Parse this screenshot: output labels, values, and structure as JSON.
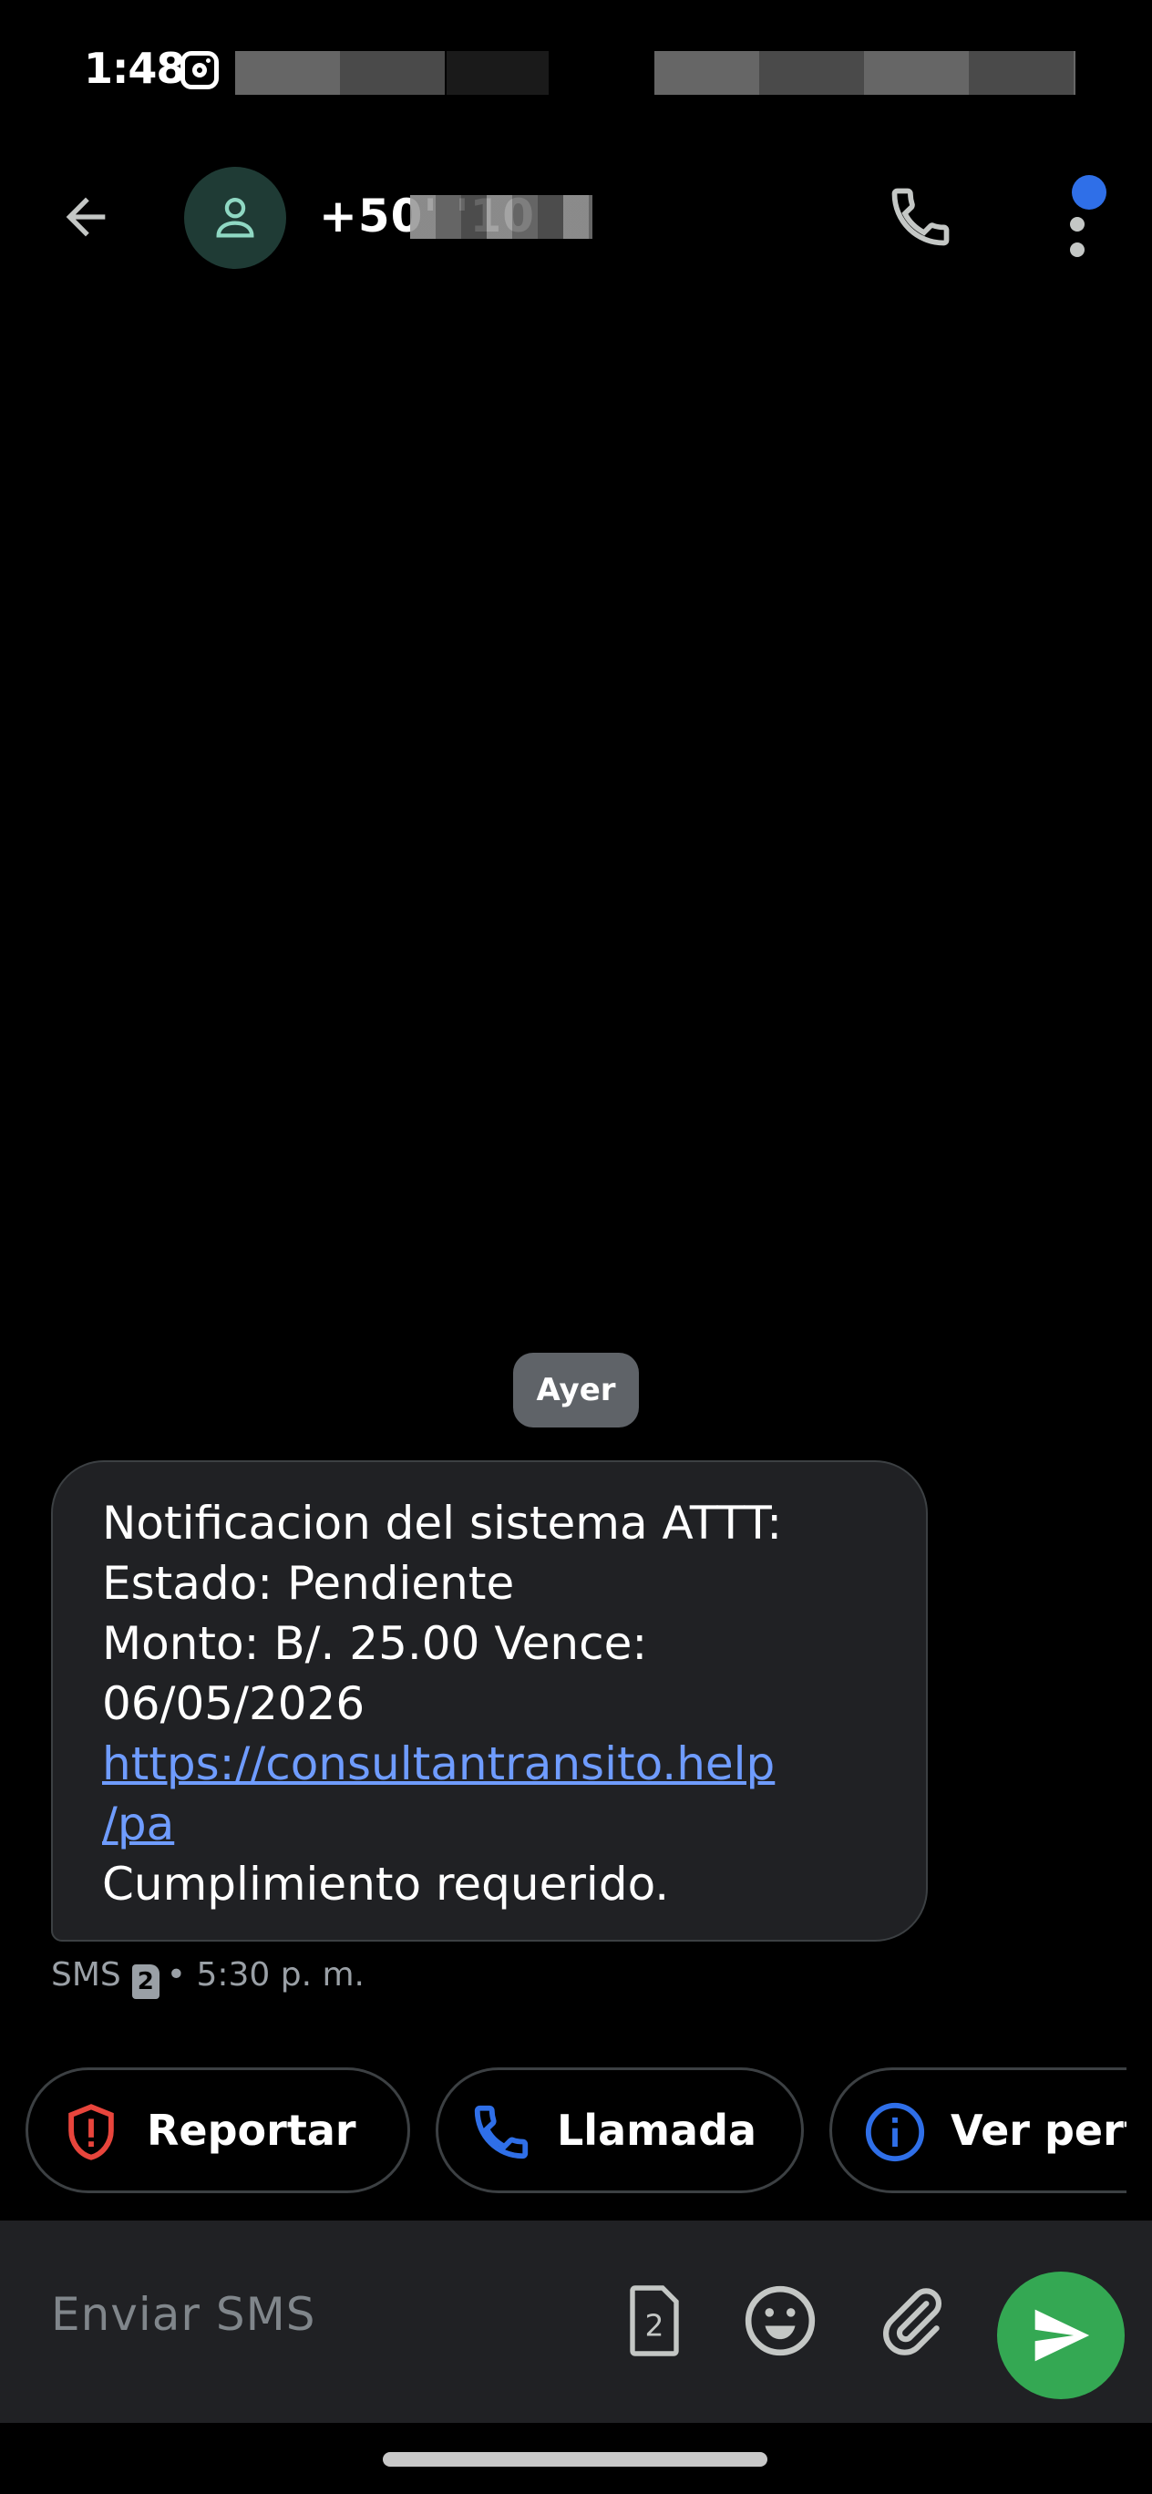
{
  "status_bar": {
    "time": "1:48"
  },
  "header": {
    "contact": "+50'        '10"
  },
  "conversation": {
    "date_label": "Ayer",
    "message": {
      "lines": [
        "Notificacion del sistema ATTT:",
        "Estado: Pendiente",
        "Monto: B/. 25.00 Vence:",
        "06/05/2026"
      ],
      "link_line1": "https://consultantransito.help",
      "link_line2": "/pa",
      "closing": "Cumplimiento requerido."
    },
    "meta": {
      "type": "SMS",
      "sim": "2",
      "time": "• 5:30 p. m."
    }
  },
  "suggestions": [
    {
      "label": "Reportar",
      "icon": "shield-alert-icon"
    },
    {
      "label": "Llamada",
      "icon": "phone-icon"
    },
    {
      "label": "Ver perfil",
      "icon": "info-icon"
    }
  ],
  "composer": {
    "placeholder": "Enviar SMS",
    "sim": "2"
  },
  "colors": {
    "background": "#000000",
    "bubble": "#202124",
    "link": "#6f9cff",
    "send": "#34a853",
    "accent": "#2f6fe8",
    "report": "#e8453c"
  }
}
